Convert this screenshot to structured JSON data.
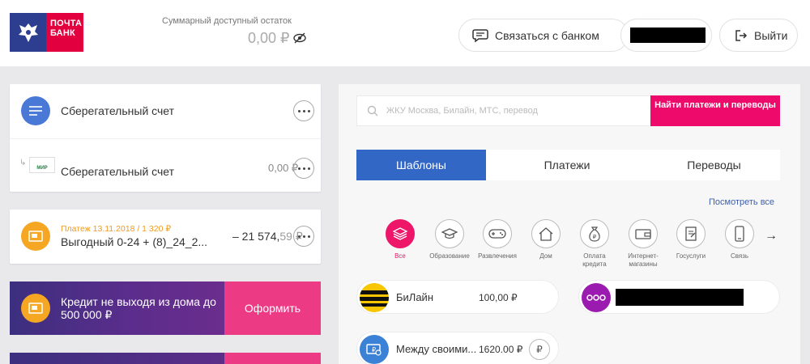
{
  "header": {
    "brand_line1": "ПОЧТА",
    "brand_line2": "БАНК",
    "balance_label": "Суммарный доступный остаток",
    "balance_amount": "0,00 ₽",
    "contact_label": "Связаться с банком",
    "exit_label": "Выйти"
  },
  "accounts": [
    {
      "name": "Сберегательный счет"
    },
    {
      "name": "Сберегательный счет",
      "amount": "0,00 ₽",
      "card_logo": "МИР"
    }
  ],
  "payment": {
    "date_line": "Платеж 13.11.2018 / 1 320 ₽",
    "name": "Выгодный 0-24 + (8)_24_2...",
    "amount_main": "– 21 574,",
    "amount_dec": "59 ₽"
  },
  "promo": {
    "text": "Кредит не выходя из дома до 500 000 ₽",
    "button_label": "Оформить"
  },
  "search": {
    "placeholder": "ЖКУ Москва, Билайн, МТС, перевод",
    "find_button": "Найти платежи и переводы"
  },
  "tabs": [
    "Шаблоны",
    "Платежи",
    "Переводы"
  ],
  "see_all": "Посмотреть все",
  "categories": [
    {
      "label": "Все",
      "icon": "layers-icon"
    },
    {
      "label": "Образование",
      "icon": "graduation-cap-icon"
    },
    {
      "label": "Развлечения",
      "icon": "gamepad-icon"
    },
    {
      "label": "Дом",
      "icon": "house-icon"
    },
    {
      "label": "Оплата кредита",
      "icon": "money-bag-icon"
    },
    {
      "label": "Интернет-магазины",
      "icon": "wallet-icon"
    },
    {
      "label": "Госуслуги",
      "icon": "document-icon"
    },
    {
      "label": "Связь",
      "icon": "phone-icon"
    }
  ],
  "templates": [
    {
      "name": "БиЛайн",
      "amount": "100,00 ₽"
    },
    {
      "name": "Между своими...",
      "amount": "1620.00 ₽",
      "rub": "₽"
    }
  ],
  "colors": {
    "accent": "#ee0a6b",
    "tab_active": "#3367c6",
    "brand_blue": "#2d3d8f",
    "brand_red": "#e3003f",
    "orange": "#f29a1f"
  }
}
